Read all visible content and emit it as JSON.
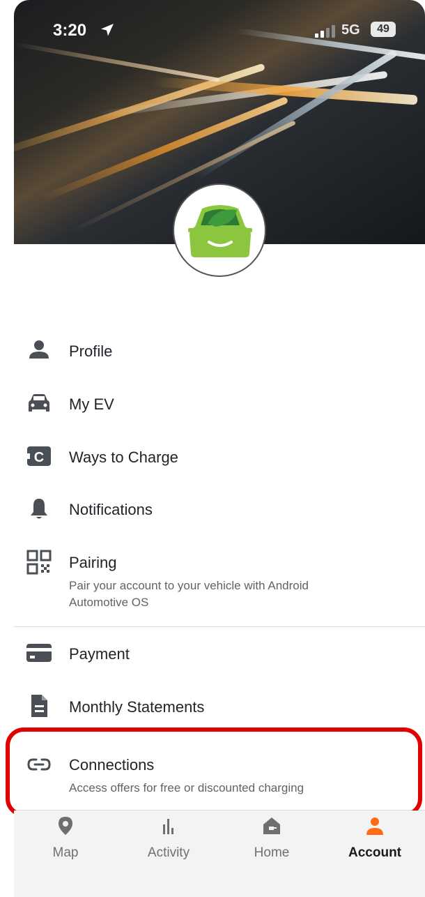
{
  "status_bar": {
    "time": "3:20",
    "network": "5G",
    "battery": "49"
  },
  "header": {
    "logo_icon": "car-leaf-logo",
    "brand_color": "#8cc63f"
  },
  "menu": {
    "items": [
      {
        "label": "Profile",
        "icon": "person-icon"
      },
      {
        "label": "My EV",
        "icon": "car-icon"
      },
      {
        "label": "Ways to Charge",
        "icon": "charge-card-icon"
      },
      {
        "label": "Notifications",
        "icon": "bell-icon"
      },
      {
        "label": "Pairing",
        "icon": "qr-code-icon",
        "subtitle": "Pair your account to your vehicle with Android Automotive OS"
      },
      {
        "label": "Payment",
        "icon": "credit-card-icon"
      },
      {
        "label": "Monthly Statements",
        "icon": "document-icon"
      },
      {
        "label": "Connections",
        "icon": "link-icon",
        "subtitle": "Access offers for free or discounted charging"
      }
    ]
  },
  "tabbar": {
    "tabs": [
      {
        "label": "Map",
        "icon": "map-pin-icon",
        "active": false
      },
      {
        "label": "Activity",
        "icon": "bar-chart-icon",
        "active": false
      },
      {
        "label": "Home",
        "icon": "home-charger-icon",
        "active": false
      },
      {
        "label": "Account",
        "icon": "person-icon",
        "active": true
      }
    ],
    "accent_color": "#ff6a13"
  },
  "highlight_color": "#e00000"
}
